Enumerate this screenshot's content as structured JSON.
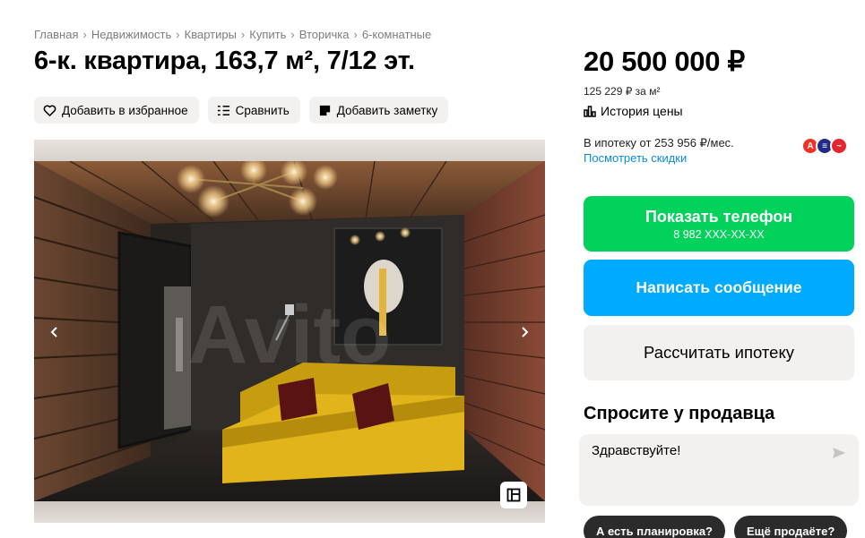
{
  "breadcrumb": [
    "Главная",
    "Недвижимость",
    "Квартиры",
    "Купить",
    "Вторичка",
    "6-комнатные"
  ],
  "title": "6-к. квартира, 163,7 м², 7/12 эт.",
  "actions": {
    "favorite": "Добавить в избранное",
    "compare": "Сравнить",
    "note": "Добавить заметку"
  },
  "gallery": {
    "watermark": "Avito"
  },
  "price": {
    "total": "20 500 000 ₽",
    "per_m2": "125 229 ₽ за м²",
    "history": "История цены"
  },
  "mortgage": {
    "text": "В ипотеку от 253 956 ₽/мес.",
    "discounts": "Посмотреть скидки",
    "bank_colors": [
      "#ef3124",
      "#1f2b86",
      "#e3262f"
    ]
  },
  "buttons": {
    "phone_label": "Показать телефон",
    "phone_number": "8 982 XXX-XX-XX",
    "message": "Написать сообщение",
    "mortgage_calc": "Рассчитать ипотеку"
  },
  "ask": {
    "title": "Спросите у продавца",
    "message": "Здравствуйте!",
    "chips": [
      "А есть планировка?",
      "Ещё продаёте?"
    ]
  },
  "colors": {
    "green": "#02d15c",
    "blue": "#00aaff",
    "link": "#0a8bd8",
    "gray_bg": "#f2f1f0"
  }
}
